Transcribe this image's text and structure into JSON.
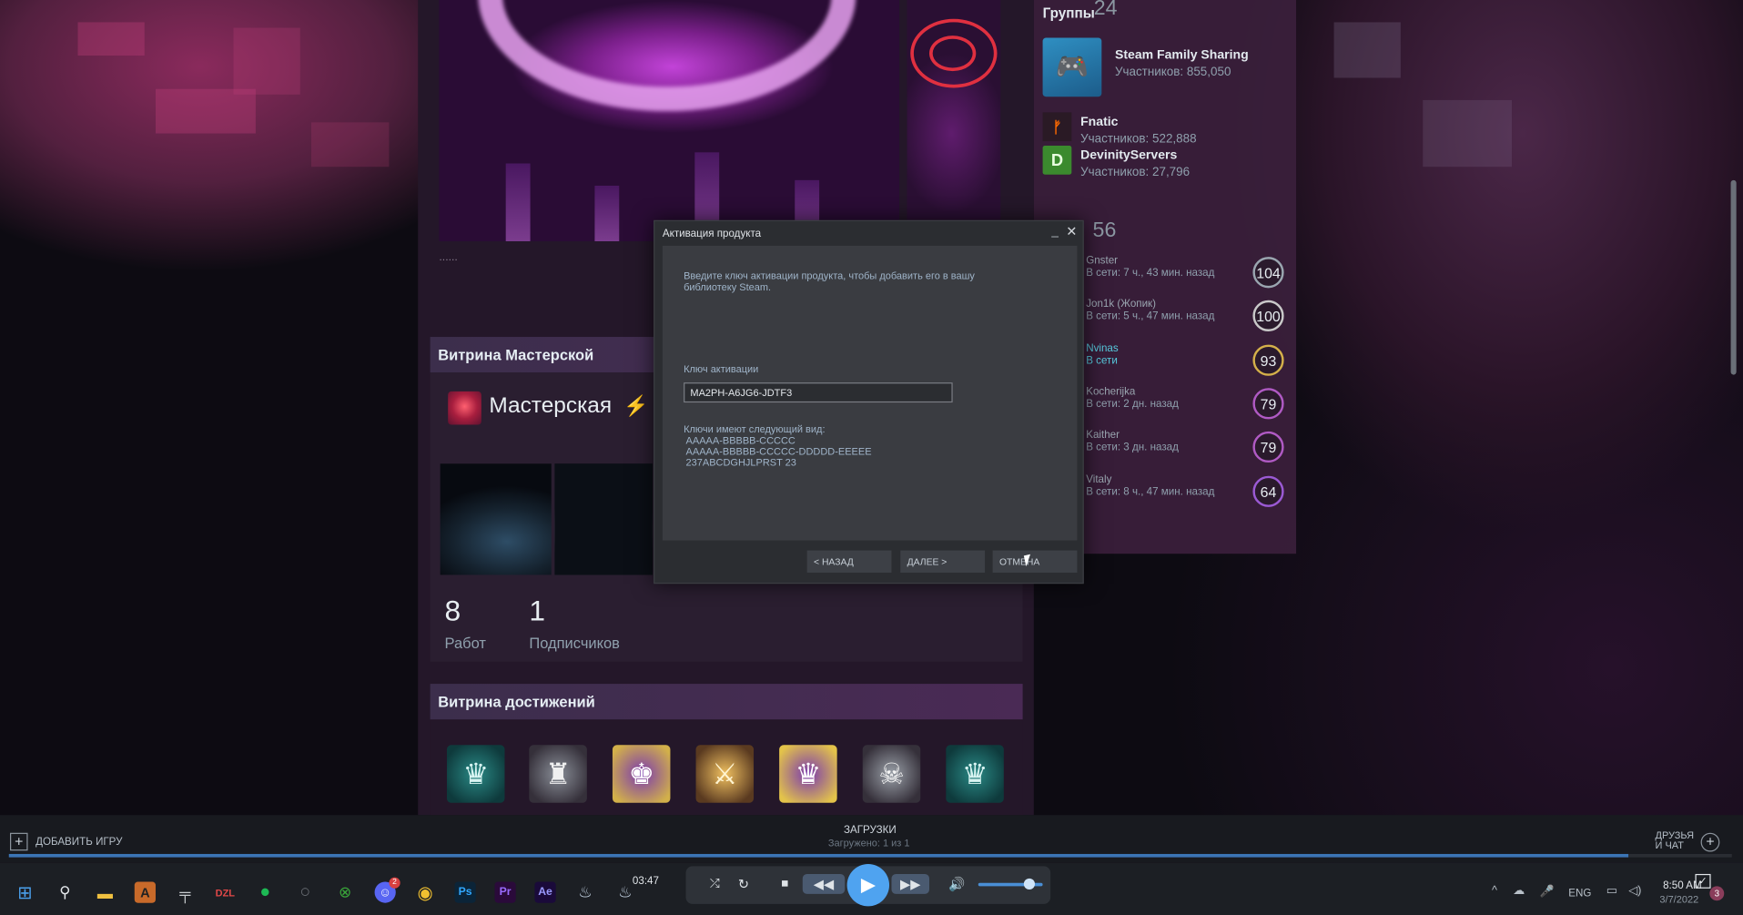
{
  "profile": {
    "dots": "......",
    "workshop": {
      "section_title": "Витрина Мастерской",
      "title": "Мастерская",
      "items_count": "8",
      "items_label": "Работ",
      "subscribers_count": "1",
      "subscribers_label": "Подписчиков"
    },
    "achievements": {
      "section_title": "Витрина достижений",
      "badges": [
        "emerald-eagle",
        "silver-crest",
        "purple-crown",
        "gold-swords",
        "purple-crest",
        "silver-skull",
        "emerald-wings"
      ]
    },
    "groups": {
      "label": "Группы",
      "count": "24",
      "items": [
        {
          "name": "Steam Family Sharing",
          "members": "Участников: 855,050"
        },
        {
          "name": "Fnatic",
          "members": "Участников: 522,888"
        },
        {
          "name": "DevinityServers",
          "members": "Участников: 27,796"
        }
      ]
    },
    "friends": {
      "count": "56",
      "items": [
        {
          "name": "Gnster",
          "status": "В сети: 7 ч., 43 мин. назад",
          "level": "104"
        },
        {
          "name": "Jon1k (Жопик)",
          "status": "В сети: 5 ч., 47 мин. назад",
          "level": "100"
        },
        {
          "name": "Nvinas",
          "status": "В сети",
          "level": "93"
        },
        {
          "name": "Kocherijka",
          "status": "В сети: 2 дн. назад",
          "level": "79"
        },
        {
          "name": "Kaither",
          "status": "В сети: 3 дн. назад",
          "level": "79"
        },
        {
          "name": "Vitaly",
          "status": "В сети: 8 ч., 47 мин. назад",
          "level": "64"
        }
      ]
    }
  },
  "dialog": {
    "title": "Активация продукта",
    "intro": "Введите ключ активации продукта, чтобы добавить его в вашу библиотеку Steam.",
    "key_label": "Ключ активации",
    "key_value": "MA2PH-A6JG6-JDTF3",
    "format_title": "Ключи имеют следующий вид:",
    "format_1": "AAAAA-BBBBB-CCCCC",
    "format_2": "AAAAA-BBBBB-CCCCC-DDDDD-EEEEE",
    "format_3": "237ABCDGHJLPRST 23",
    "back": "< НАЗАД",
    "next": "ДАЛЕЕ >",
    "cancel": "ОТМЕНА"
  },
  "steam_bar": {
    "add_game": "ДОБАВИТЬ ИГРУ",
    "downloads_title": "ЗАГРУЗКИ",
    "downloads_sub": "Загружено: 1 из 1",
    "download_progress": 0.94,
    "friends_line1": "ДРУЗЬЯ",
    "friends_line2": "И ЧАТ"
  },
  "taskbar": {
    "player_time": "03:47",
    "language": "ENG",
    "clock_time": "8:50 AM",
    "clock_date": "3/7/2022",
    "notifications_count": "3",
    "discord_badge": "2",
    "volume_level": 0.8
  },
  "colors": {
    "accent_blue": "#4fa3f0",
    "lvl_104": "#9aa6b0",
    "lvl_100": "#c9c9c9",
    "lvl_93": "#d4b04a",
    "lvl_79": "#b05ac4",
    "lvl_64": "#9b5ad4"
  }
}
